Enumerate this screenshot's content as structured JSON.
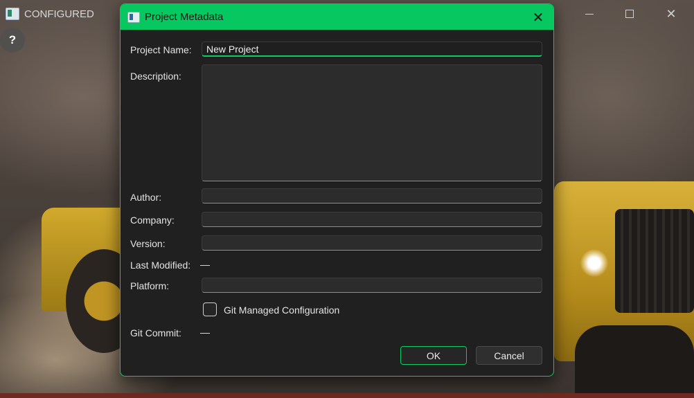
{
  "window": {
    "title": "CONFIGURED",
    "help_label": "?",
    "close_glyph": "✕"
  },
  "dialog": {
    "title": "Project Metadata",
    "close_glyph": "✕",
    "accent_color": "#07c760",
    "fields": {
      "project_name": {
        "label": "Project Name:",
        "value": "New Project"
      },
      "description": {
        "label": "Description:",
        "value": ""
      },
      "author": {
        "label": "Author:",
        "value": ""
      },
      "company": {
        "label": "Company:",
        "value": ""
      },
      "version": {
        "label": "Version:",
        "value": ""
      },
      "last_modified": {
        "label": "Last Modified:",
        "value": "—"
      },
      "platform": {
        "label": "Platform:",
        "value": ""
      },
      "git_commit": {
        "label": "Git Commit:",
        "value": "—"
      }
    },
    "git_managed": {
      "label": "Git Managed Configuration",
      "checked": false
    },
    "buttons": {
      "ok": "OK",
      "cancel": "Cancel"
    }
  }
}
